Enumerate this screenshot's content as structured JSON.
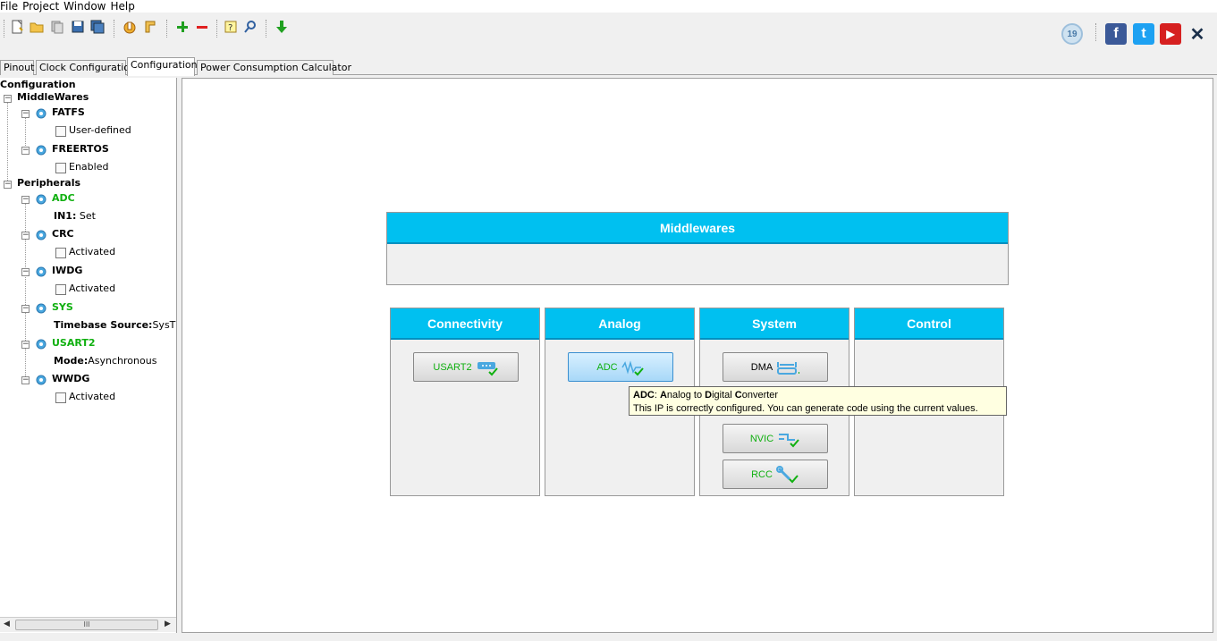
{
  "menu": [
    "File",
    "Project",
    "Window",
    "Help"
  ],
  "toolbar": {
    "icons": [
      "new-file-icon",
      "open-folder-icon",
      "copy-icon",
      "save-icon",
      "save-all-icon",
      "generate-report-icon",
      "generate-code-icon",
      "add-icon",
      "remove-icon",
      "help-icon",
      "search-icon",
      "download-icon"
    ],
    "right": {
      "version_badge": "19",
      "facebook": "f",
      "twitter": "t",
      "youtube": "▶",
      "network": "✕"
    }
  },
  "tabs": [
    {
      "label": "Pinout",
      "active": false
    },
    {
      "label": "Clock Configuration",
      "active": false
    },
    {
      "label": "Configuration",
      "active": true
    },
    {
      "label": "Power Consumption Calculator",
      "active": false
    }
  ],
  "tree": {
    "root": "Configuration",
    "middlewares": "MiddleWares",
    "fatfs": "FATFS",
    "fatfs_child": "User-defined",
    "freertos": "FREERTOS",
    "freertos_child": "Enabled",
    "peripherals": "Peripherals",
    "adc": "ADC",
    "adc_child_key": "IN1:",
    "adc_child_val": " Set",
    "crc": "CRC",
    "crc_child": "Activated",
    "iwdg": "IWDG",
    "iwdg_child": "Activated",
    "sys": "SYS",
    "sys_child_key": "Timebase Source:",
    "sys_child_val": "SysTick",
    "usart2": "USART2",
    "usart2_child_key": "Mode:",
    "usart2_child_val": "Asynchronous",
    "wwdg": "WWDG",
    "wwdg_child": "Activated",
    "scroll_grip": "III"
  },
  "main": {
    "middlewares_header": "Middlewares",
    "categories": {
      "connectivity": "Connectivity",
      "analog": "Analog",
      "system": "System",
      "control": "Control"
    },
    "buttons": {
      "usart2": "USART2",
      "adc": "ADC",
      "dma": "DMA",
      "nvic": "NVIC",
      "rcc": "RCC"
    },
    "tooltip": {
      "title_a": "ADC",
      "title_b": ": ",
      "title_c": "A",
      "title_d": "nalog to ",
      "title_e": "D",
      "title_f": "igital ",
      "title_g": "C",
      "title_h": "onverter",
      "body": "This IP is correctly configured. You can generate code using the current values."
    }
  },
  "colors": {
    "header_blue": "#00c0f0",
    "ok_green": "#10b010",
    "tooltip_bg": "#ffffe1"
  }
}
